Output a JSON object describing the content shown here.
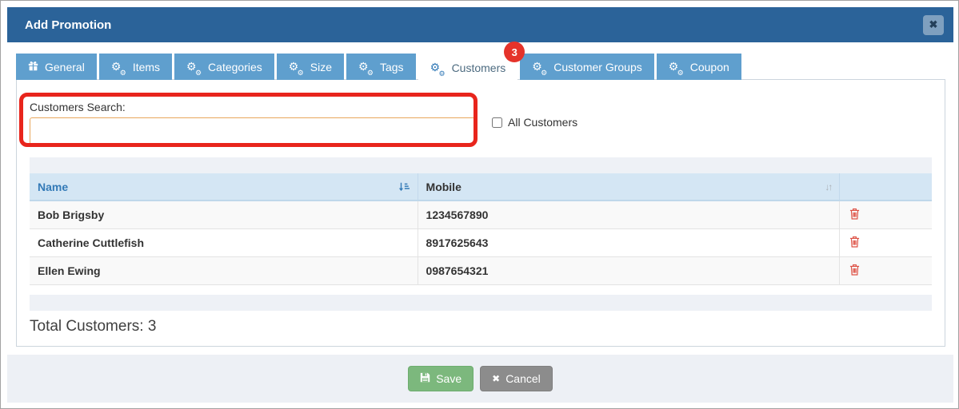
{
  "modal": {
    "title": "Add Promotion"
  },
  "icons": {
    "gear": "⚙",
    "close_x": "✖",
    "cancel_x": "✖",
    "sort_both": "↓↑"
  },
  "tabs": [
    {
      "label": "General",
      "icon": "gift-icon",
      "active": false
    },
    {
      "label": "Items",
      "icon": "cogs-icon",
      "active": false
    },
    {
      "label": "Categories",
      "icon": "cogs-icon",
      "active": false
    },
    {
      "label": "Size",
      "icon": "cogs-icon",
      "active": false
    },
    {
      "label": "Tags",
      "icon": "cogs-icon",
      "active": false
    },
    {
      "label": "Customers",
      "icon": "cogs-icon",
      "active": true,
      "badge": "3"
    },
    {
      "label": "Customer Groups",
      "icon": "cogs-icon",
      "active": false
    },
    {
      "label": "Coupon",
      "icon": "cogs-icon",
      "active": false
    }
  ],
  "search": {
    "label": "Customers Search:",
    "value": "",
    "placeholder": ""
  },
  "all_customers": {
    "label": "All Customers",
    "checked": false
  },
  "table": {
    "columns": [
      {
        "label": "Name",
        "sort": "ascending"
      },
      {
        "label": "Mobile",
        "sort": "unsorted"
      },
      {
        "label": "",
        "sort": "none"
      }
    ],
    "rows": [
      {
        "name": "Bob Brigsby",
        "mobile": "1234567890"
      },
      {
        "name": "Catherine Cuttlefish",
        "mobile": "8917625643"
      },
      {
        "name": "Ellen Ewing",
        "mobile": "0987654321"
      }
    ]
  },
  "summary": {
    "total": "Total Customers: 3"
  },
  "buttons": {
    "save": "Save",
    "cancel": "Cancel"
  },
  "colors": {
    "header_blue": "#2b6399",
    "tab_blue": "#5f9fce",
    "active_icon_blue": "#337ab7",
    "table_header_blue": "#d4e6f4",
    "badge_red": "#e5332a",
    "annotation_red": "#e8251c",
    "trash_red": "#dd5145",
    "input_orange": "#e9a75c",
    "save_green": "#7cb87d",
    "cancel_gray": "#8c8c8c"
  }
}
